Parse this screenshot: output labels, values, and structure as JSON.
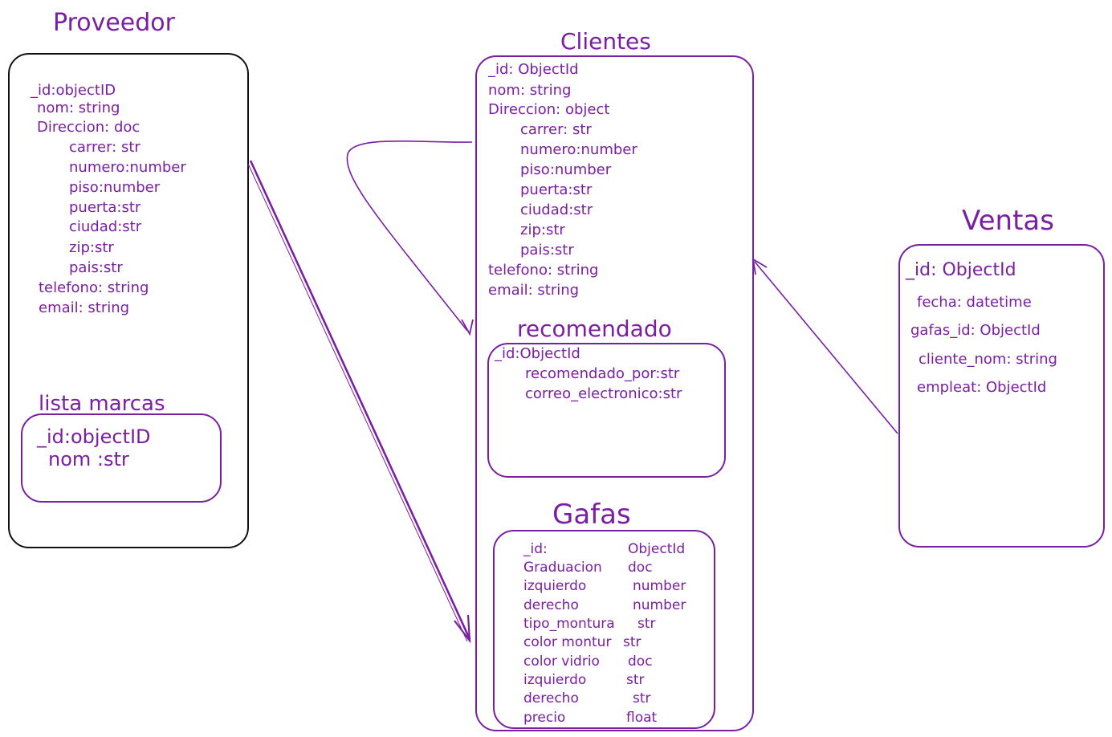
{
  "proveedor": {
    "title": "Proveedor",
    "fields": [
      "_id:objectID",
      "nom: string",
      "Direccion: doc",
      "carrer: str",
      "numero:number",
      "piso:number",
      "puerta:str",
      "ciudad:str",
      "zip:str",
      "pais:str",
      "telefono: string",
      "email: string"
    ]
  },
  "lista_marcas": {
    "title": "lista marcas",
    "fields": [
      "_id:objectID",
      "nom :str"
    ]
  },
  "clientes": {
    "title": "Clientes",
    "fields": [
      "_id: ObjectId",
      "nom: string",
      "Direccion: object",
      "carrer: str",
      "numero:number",
      "piso:number",
      "puerta:str",
      "ciudad:str",
      "zip:str",
      "pais:str",
      "telefono: string",
      "email: string"
    ]
  },
  "recomendado": {
    "title": "recomendado",
    "fields": [
      "_id:ObjectId",
      "recomendado_por:str",
      "correo_electronico:str"
    ]
  },
  "gafas": {
    "title": "Gafas",
    "rows": [
      {
        "name": "_id:",
        "type": "ObjectId"
      },
      {
        "name": "Graduacion",
        "type": "doc"
      },
      {
        "name": "izquierdo",
        "type": "number"
      },
      {
        "name": "derecho",
        "type": "number"
      },
      {
        "name": "tipo_montura",
        "type": "str"
      },
      {
        "name": "color montur",
        "type": "str"
      },
      {
        "name": "color vidrio",
        "type": "doc"
      },
      {
        "name": "izquierdo",
        "type": "str"
      },
      {
        "name": "derecho",
        "type": "str"
      },
      {
        "name": "precio",
        "type": "float"
      }
    ]
  },
  "ventas": {
    "title": "Ventas",
    "fields": [
      "_id: ObjectId",
      "fecha: datetime",
      "gafas_id: ObjectId",
      "cliente_nom: string",
      "empleat: ObjectId"
    ]
  },
  "colors": {
    "stroke": "#7a1fa2",
    "box_black": "#111111",
    "background": "#ffffff"
  }
}
